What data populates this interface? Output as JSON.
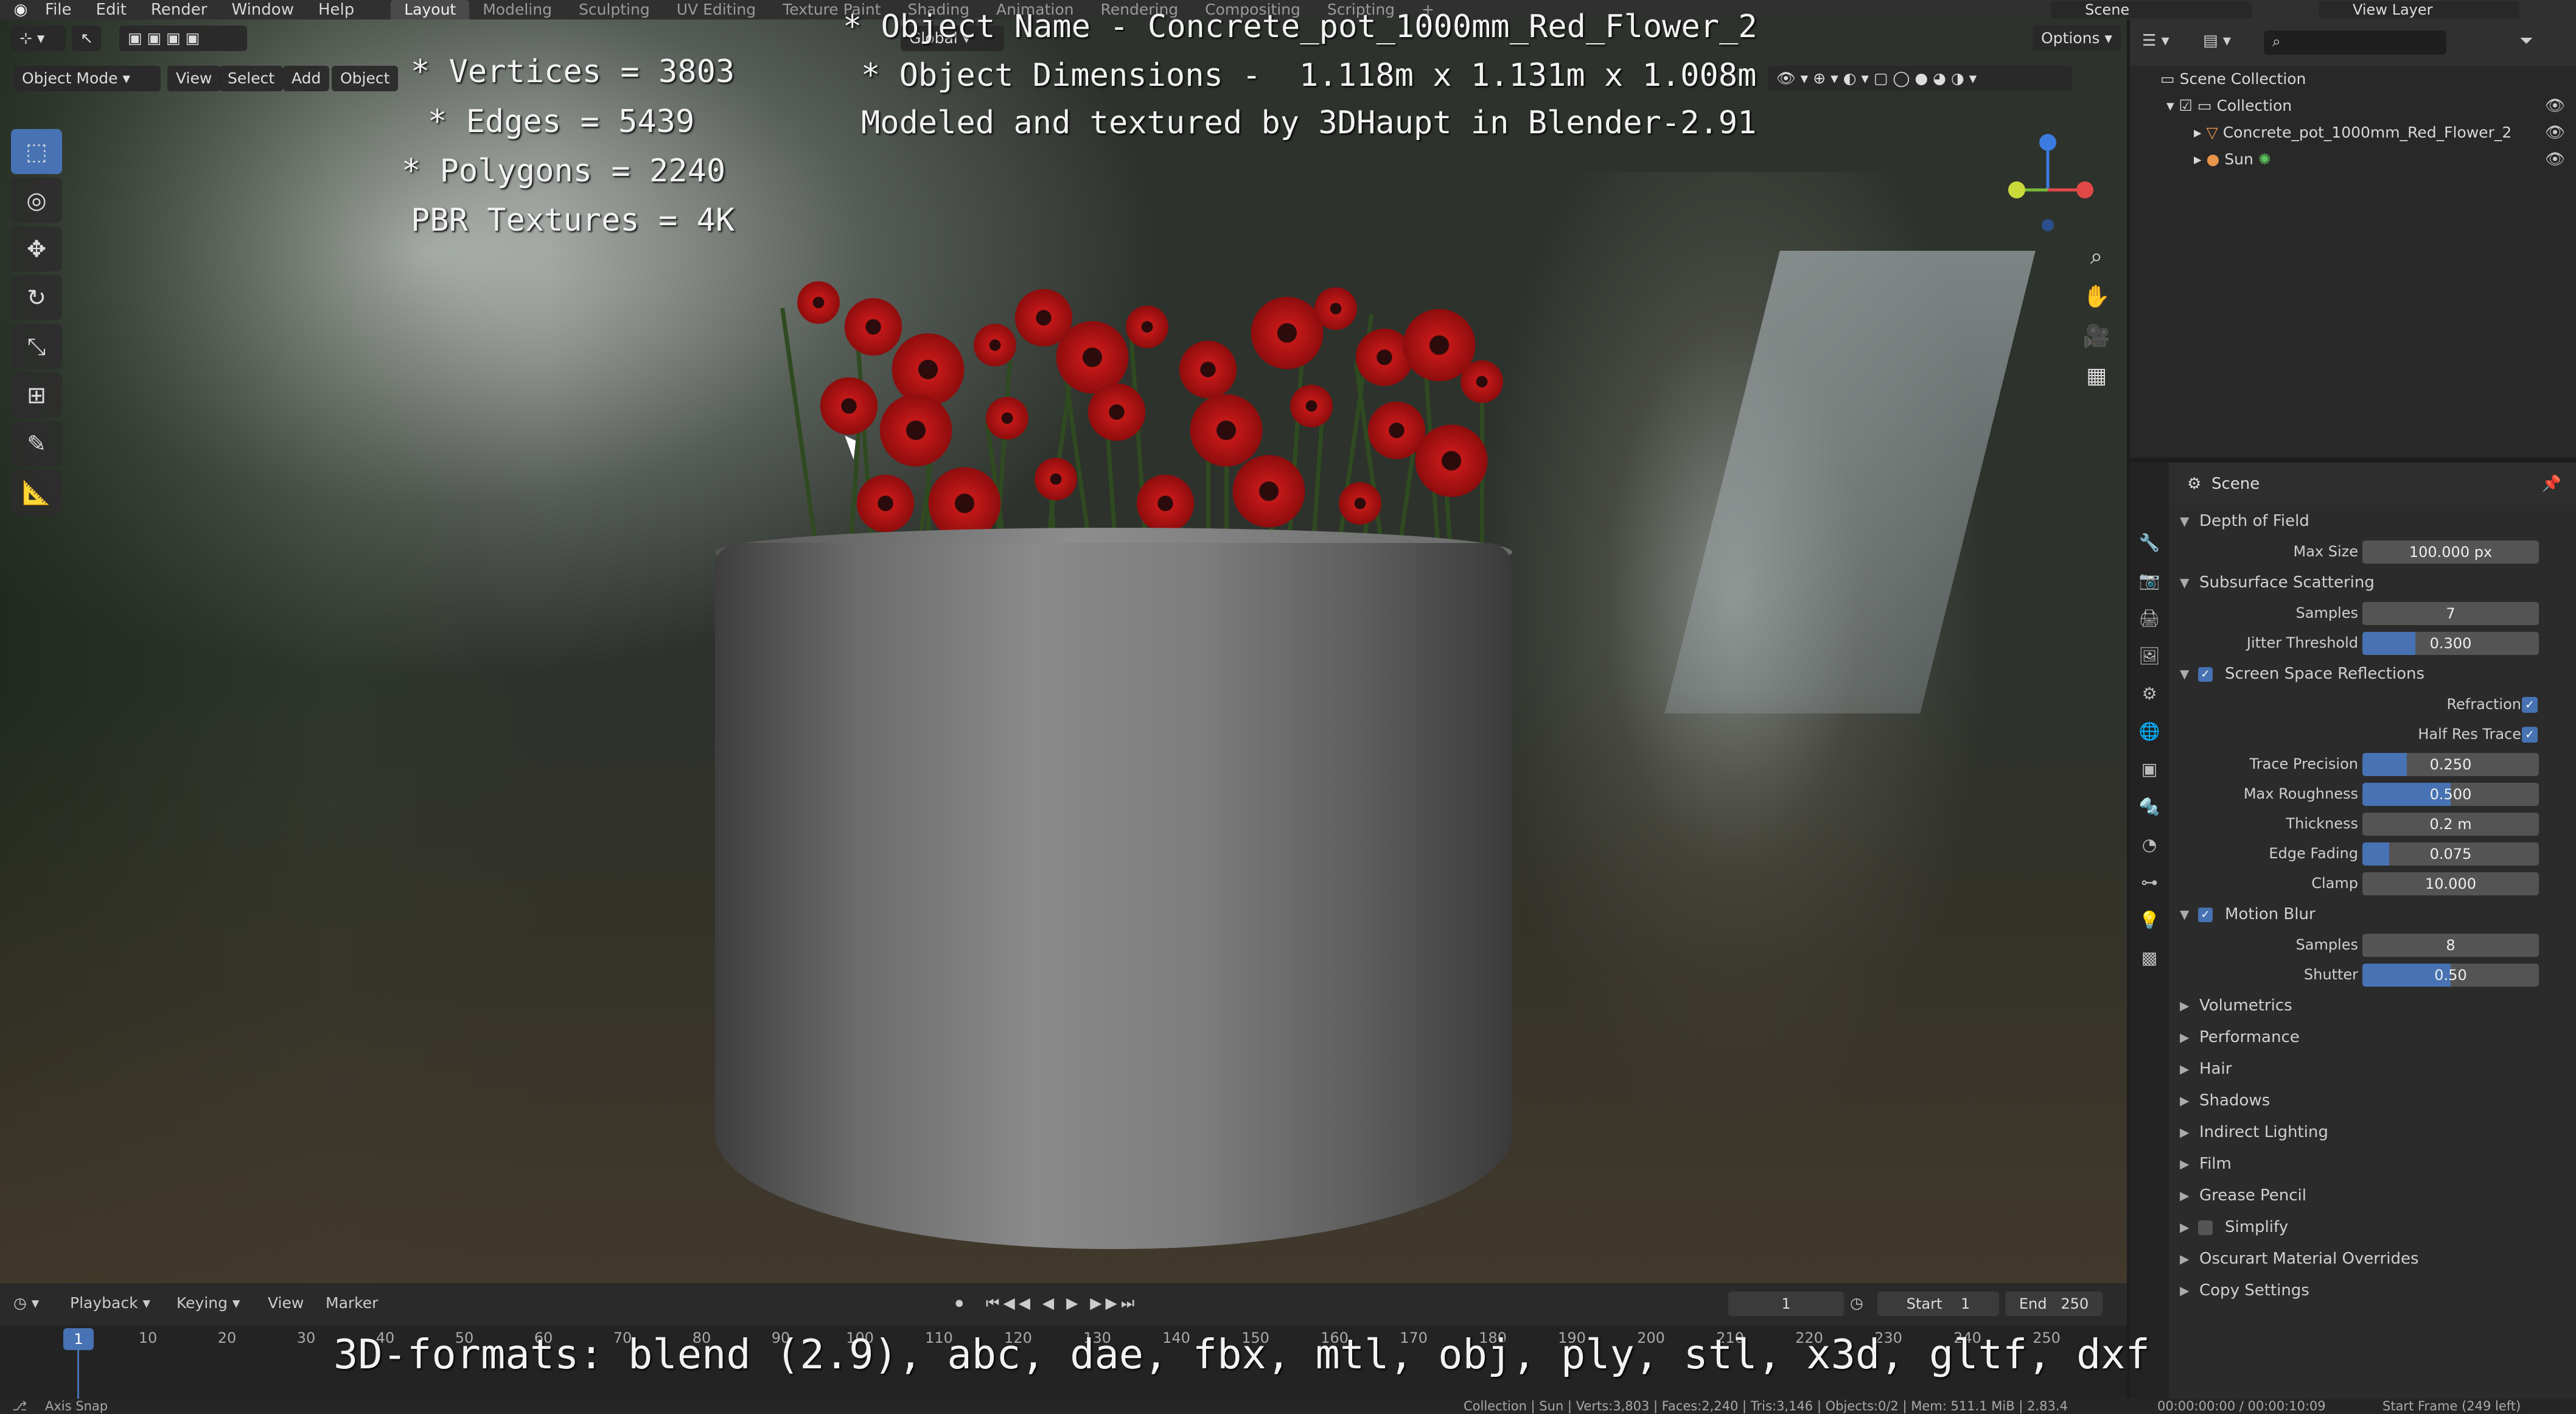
{
  "topbar": {
    "menus": [
      "File",
      "Edit",
      "Render",
      "Window",
      "Help"
    ],
    "workspaces": [
      "Layout",
      "Modeling",
      "Sculpting",
      "UV Editing",
      "Texture Paint",
      "Shading",
      "Animation",
      "Rendering",
      "Compositing",
      "Scripting"
    ],
    "add_tab": "+",
    "scene": "Scene",
    "view_layer": "View Layer"
  },
  "viewport": {
    "mode": "Object Mode",
    "menus": [
      "View",
      "Select",
      "Add",
      "Object"
    ],
    "orientation": "Global",
    "options": "Options"
  },
  "overlay": {
    "vertices": "* Vertices = 3803",
    "edges": "* Edges = 5439",
    "polygons": "* Polygons = 2240",
    "textures": "PBR Textures = 4K",
    "object_name": "* Object Name - Concrete_pot_1000mm_Red_Flower_2",
    "object_dims": "* Object Dimensions -  1.118m x 1.131m x 1.008m",
    "credit": "Modeled and textured by 3DHaupt in Blender-2.91",
    "formats": "3D-formats: blend (2.9), abc, dae, fbx, mtl, obj, ply, stl, x3d, gltf, dxf"
  },
  "outliner": {
    "scene_collection": "Scene Collection",
    "collection": "Collection",
    "object": "Concrete_pot_1000mm_Red_Flower_2",
    "sun": "Sun"
  },
  "properties": {
    "header": "Scene",
    "dof": {
      "title": "Depth of Field",
      "max_size_label": "Max Size",
      "max_size": "100.000 px"
    },
    "sss": {
      "title": "Subsurface Scattering",
      "samples_label": "Samples",
      "samples": "7",
      "jitter_label": "Jitter Threshold",
      "jitter": "0.300",
      "jitter_fill": 0.3
    },
    "ssr": {
      "title": "Screen Space Reflections",
      "refraction_label": "Refraction",
      "half_res_label": "Half Res Trace",
      "trace_precision_label": "Trace Precision",
      "trace_precision": "0.250",
      "trace_precision_fill": 0.25,
      "max_roughness_label": "Max Roughness",
      "max_roughness": "0.500",
      "max_roughness_fill": 0.5,
      "thickness_label": "Thickness",
      "thickness": "0.2 m",
      "edge_fading_label": "Edge Fading",
      "edge_fading": "0.075",
      "edge_fading_fill": 0.15,
      "clamp_label": "Clamp",
      "clamp": "10.000"
    },
    "motion_blur": {
      "title": "Motion Blur",
      "samples_label": "Samples",
      "samples": "8",
      "shutter_label": "Shutter",
      "shutter": "0.50",
      "shutter_fill": 0.5
    },
    "collapsed": [
      "Volumetrics",
      "Performance",
      "Hair",
      "Shadows",
      "Indirect Lighting",
      "Film",
      "Grease Pencil",
      "Simplify",
      "Oscurart Material Overrides",
      "Copy Settings"
    ]
  },
  "timeline": {
    "menus": [
      "Playback",
      "Keying",
      "View",
      "Marker"
    ],
    "current_frame": "1",
    "start_label": "Start",
    "start": "1",
    "end_label": "End",
    "end": "250",
    "ticks": [
      "10",
      "20",
      "30",
      "40",
      "50",
      "60",
      "70",
      "80",
      "90",
      "100",
      "110",
      "120",
      "130",
      "140",
      "150",
      "160",
      "170",
      "180",
      "190",
      "200",
      "210",
      "220",
      "230",
      "240",
      "250"
    ]
  },
  "status": {
    "left": "Axis Snap",
    "stats": "Collection | Sun | Verts:3,803 | Faces:2,240 | Tris:3,146 | Objects:0/2 | Mem: 511.1 MiB | 2.83.4",
    "time": "00:00:00:00 / 00:00:10:09",
    "start_frame": "Start Frame (249 left)"
  },
  "colors": {
    "accent": "#4772b3",
    "flower": "#c31818"
  }
}
